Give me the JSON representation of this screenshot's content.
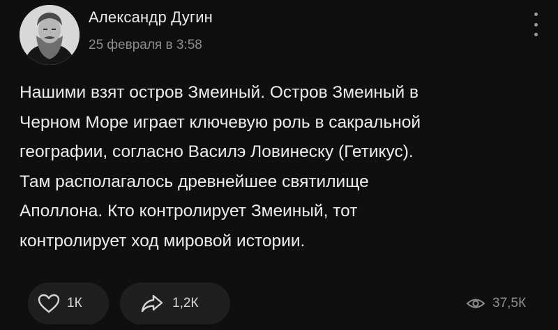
{
  "post": {
    "author": "Александр Дугин",
    "date": "25 февраля в 3:58",
    "text": "Нашими взят остров Змеиный. Остров Змеиный в\nЧерном Море играет ключевую роль в сакральной\nгеографии, согласно Василэ Ловинеску (Гетикус).\nТам располагалось древнейшее святилище\nАполлона. Кто контролирует Змеиный, тот\nконтролирует ход мировой истории."
  },
  "actions": {
    "likes": "1К",
    "shares": "1,2К",
    "views": "37,5К"
  },
  "icons": {
    "like": "heart-outline-icon",
    "share": "share-arrow-icon",
    "views": "eye-icon",
    "menu": "vertical-dots-icon"
  },
  "colors": {
    "background": "#0f0f0f",
    "pill": "#1f1f1f",
    "text": "#ededed",
    "muted": "#8d8d8d"
  }
}
